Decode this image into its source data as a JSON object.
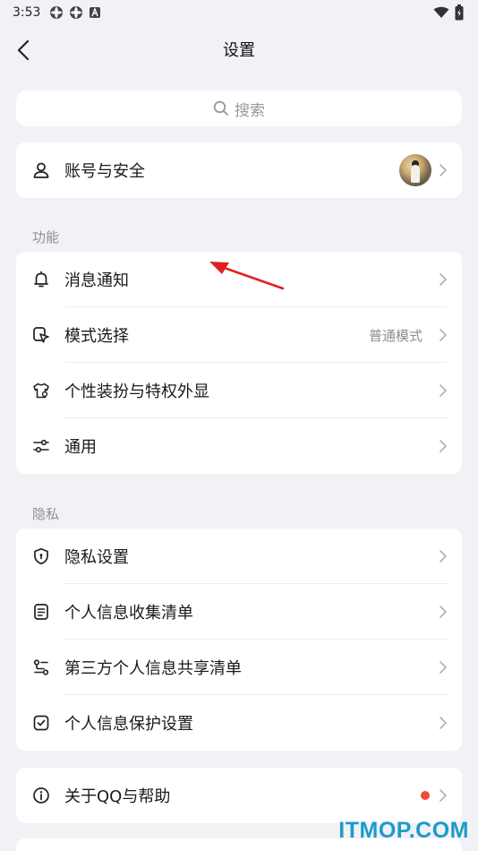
{
  "status_bar": {
    "time": "3:53"
  },
  "nav": {
    "title": "设置"
  },
  "search": {
    "placeholder": "搜索"
  },
  "account": {
    "label": "账号与安全"
  },
  "sections": {
    "features": "功能",
    "privacy": "隐私"
  },
  "features": [
    {
      "label": "消息通知",
      "value": ""
    },
    {
      "label": "模式选择",
      "value": "普通模式"
    },
    {
      "label": "个性装扮与特权外显",
      "value": ""
    },
    {
      "label": "通用",
      "value": ""
    }
  ],
  "privacy": [
    {
      "label": "隐私设置"
    },
    {
      "label": "个人信息收集清单"
    },
    {
      "label": "第三方个人信息共享清单"
    },
    {
      "label": "个人信息保护设置"
    }
  ],
  "about": {
    "label": "关于QQ与帮助"
  },
  "watermark": "ITMOP.COM",
  "colors": {
    "background": "#f2f2f6",
    "card": "#ffffff",
    "annotation_arrow": "#e02020",
    "badge": "#f04a3c",
    "watermark": "#1a9cc9"
  },
  "icons": [
    "back-icon",
    "search-icon",
    "user-icon",
    "bell-icon",
    "mode-icon",
    "shirt-icon",
    "sliders-icon",
    "shield-icon",
    "document-icon",
    "share-icon",
    "checkbox-icon",
    "info-icon",
    "chevron-right-icon"
  ]
}
